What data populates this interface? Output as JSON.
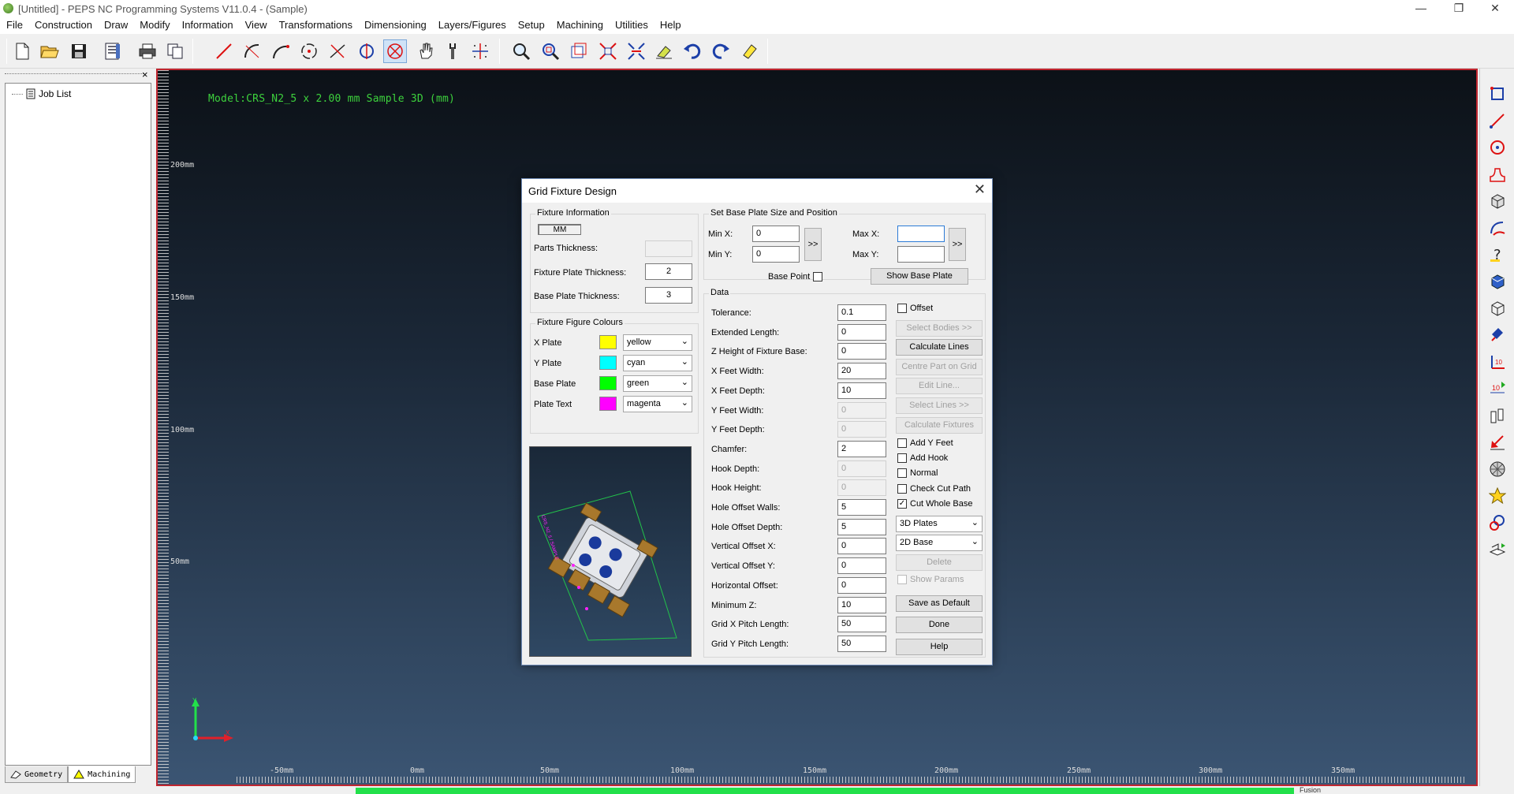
{
  "window": {
    "title": "[Untitled] - PEPS NC Programming Systems V11.0.4 - (Sample)",
    "minimize": "—",
    "restore": "❐",
    "close": "✕"
  },
  "menu": [
    "File",
    "Construction",
    "Draw",
    "Modify",
    "Information",
    "View",
    "Transformations",
    "Dimensioning",
    "Layers/Figures",
    "Setup",
    "Machining",
    "Utilities",
    "Help"
  ],
  "toolbar": {
    "icons": [
      "new-icon",
      "open-icon",
      "save-icon",
      "properties-icon",
      "print-icon",
      "copy-icon",
      "line-icon",
      "arc-icon",
      "arc2-icon",
      "circle-icon",
      "tangent-icon",
      "rotate-icon",
      "cancel-select-icon",
      "hand-icon",
      "tool-icon",
      "grid-points-icon",
      "zoom-icon",
      "zoom-window-icon",
      "zoom-layers-icon",
      "zoom-extents-icon",
      "zoom-fit-icon",
      "eraser-icon",
      "undo-icon",
      "redo-icon",
      "clear-icon"
    ]
  },
  "left_panel": {
    "close": "×",
    "tree_root": "Job List",
    "tabs": [
      "Geometry",
      "Machining"
    ]
  },
  "viewport": {
    "caption": "Model:CRS_N2_5 x 2.00 mm  Sample 3D (mm)",
    "v_labels": [
      "200mm",
      "150mm",
      "100mm",
      "50mm"
    ],
    "h_labels": [
      "-50mm",
      "0mm",
      "50mm",
      "100mm",
      "150mm",
      "200mm",
      "250mm",
      "300mm",
      "350mm"
    ],
    "axis_y": "Y",
    "axis_x": "X",
    "status_text": "Fusion"
  },
  "dialog": {
    "title": "Grid Fixture Design",
    "close": "✕",
    "fixture_info": {
      "title": "Fixture Information",
      "units": "MM",
      "parts_thickness_label": "Parts Thickness:",
      "parts_thickness": "",
      "fixture_plate_thickness_label": "Fixture Plate Thickness:",
      "fixture_plate_thickness": "2",
      "base_plate_thickness_label": "Base Plate Thickness:",
      "base_plate_thickness": "3"
    },
    "colours": {
      "title": "Fixture Figure Colours",
      "rows": [
        {
          "label": "X Plate",
          "value": "yellow",
          "color": "#ffff00"
        },
        {
          "label": "Y Plate",
          "value": "cyan",
          "color": "#00ffff"
        },
        {
          "label": "Base Plate",
          "value": "green",
          "color": "#00ff00"
        },
        {
          "label": "Plate Text",
          "value": "magenta",
          "color": "#ff00ff"
        }
      ]
    },
    "base_plate": {
      "title": "Set Base Plate Size and Position",
      "min_x_label": "Min X:",
      "min_x": "0",
      "min_y_label": "Min Y:",
      "min_y": "0",
      "max_x_label": "Max X:",
      "max_x": "",
      "max_y_label": "Max Y:",
      "max_y": "",
      "arrow": ">>",
      "base_point_label": "Base Point",
      "show_base_plate": "Show Base Plate"
    },
    "data": {
      "title": "Data",
      "rows": [
        {
          "label": "Tolerance:",
          "value": "0.1",
          "disabled": false
        },
        {
          "label": "Extended Length:",
          "value": "0",
          "disabled": false
        },
        {
          "label": "Z Height of Fixture Base:",
          "value": "0",
          "disabled": false
        },
        {
          "label": "X Feet Width:",
          "value": "20",
          "disabled": false
        },
        {
          "label": "X Feet Depth:",
          "value": "10",
          "disabled": false
        },
        {
          "label": "Y Feet Width:",
          "value": "0",
          "disabled": true
        },
        {
          "label": "Y Feet Depth:",
          "value": "0",
          "disabled": true
        },
        {
          "label": "Chamfer:",
          "value": "2",
          "disabled": false
        },
        {
          "label": "Hook Depth:",
          "value": "0",
          "disabled": true
        },
        {
          "label": "Hook Height:",
          "value": "0",
          "disabled": true
        },
        {
          "label": "Hole Offset Walls:",
          "value": "5",
          "disabled": false
        },
        {
          "label": "Hole Offset Depth:",
          "value": "5",
          "disabled": false
        },
        {
          "label": "Vertical Offset X:",
          "value": "0",
          "disabled": false
        },
        {
          "label": "Vertical Offset Y:",
          "value": "0",
          "disabled": false
        },
        {
          "label": "Horizontal Offset:",
          "value": "0",
          "disabled": false
        },
        {
          "label": "Minimum Z:",
          "value": "10",
          "disabled": false
        },
        {
          "label": "Grid X Pitch Length:",
          "value": "50",
          "disabled": false
        },
        {
          "label": "Grid Y Pitch Length:",
          "value": "50",
          "disabled": false
        }
      ]
    },
    "side": {
      "offset": {
        "label": "Offset",
        "checked": false
      },
      "select_bodies": "Select Bodies >>",
      "calculate_lines": "Calculate Lines",
      "centre_part": "Centre Part on Grid",
      "edit_line": "Edit Line...",
      "select_lines": "Select Lines >>",
      "calculate_fixtures": "Calculate Fixtures",
      "add_y_feet": {
        "label": "Add Y Feet",
        "checked": false
      },
      "add_hook": {
        "label": "Add Hook",
        "checked": false
      },
      "normal": {
        "label": "Normal",
        "checked": false
      },
      "check_cut_path": {
        "label": "Check Cut Path",
        "checked": false
      },
      "cut_whole_base": {
        "label": "Cut Whole Base",
        "checked": true
      },
      "plates_select": "3D Plates",
      "base_select": "2D Base",
      "delete": "Delete",
      "show_params": {
        "label": "Show Params",
        "checked": false
      },
      "save_default": "Save as Default",
      "done": "Done",
      "help": "Help"
    },
    "preview_text": "CRS_N2_5 / SAMPLE"
  },
  "colors": {
    "accent_border": "#c0262f",
    "caption_green": "#3dd23d",
    "status_green": "#22e04a"
  }
}
